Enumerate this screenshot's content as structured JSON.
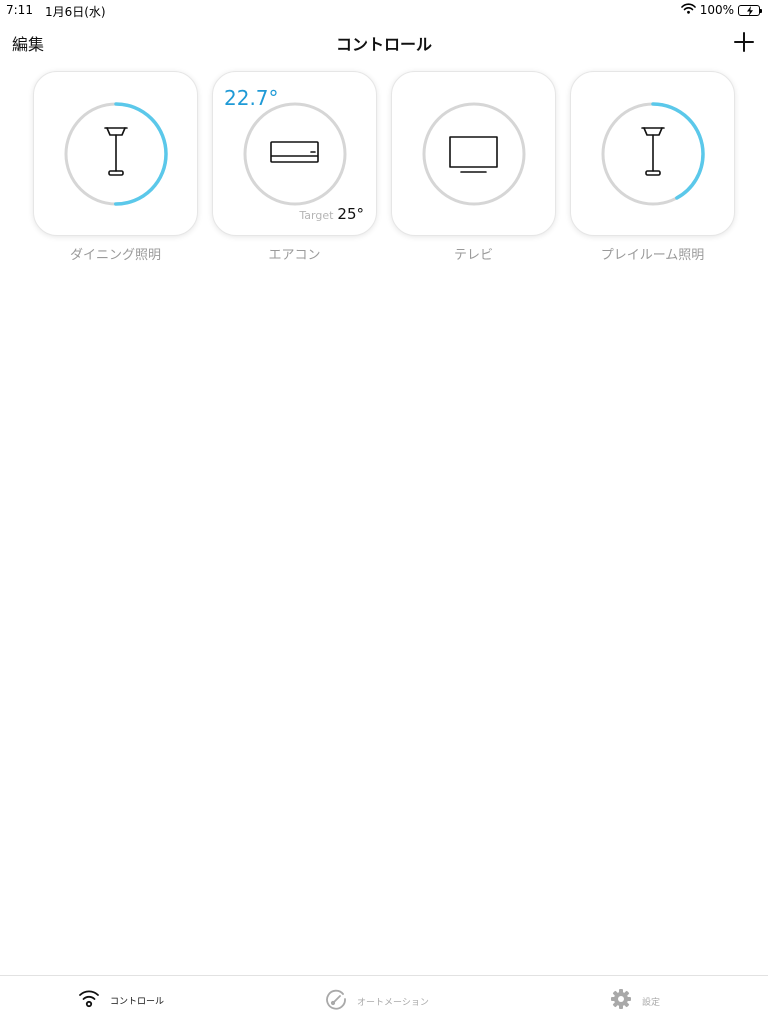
{
  "status_bar": {
    "time": "7:11",
    "date": "1月6日(水)",
    "battery": "100%"
  },
  "nav": {
    "edit_label": "編集",
    "title": "コントロール",
    "add_icon": "plus-icon"
  },
  "accent_color": "#5bc8ea",
  "devices": [
    {
      "label": "ダイニング照明",
      "icon": "floor-lamp-icon",
      "level": 0.5
    },
    {
      "label": "エアコン",
      "icon": "air-conditioner-icon",
      "current_temp": "22.7°",
      "target_label": "Target",
      "target_temp": "25°"
    },
    {
      "label": "テレビ",
      "icon": "tv-icon"
    },
    {
      "label": "プレイルーム照明",
      "icon": "floor-lamp-icon",
      "level": 0.42
    }
  ],
  "tabs": [
    {
      "label": "コントロール",
      "icon": "wifi-icon",
      "active": true
    },
    {
      "label": "オートメーション",
      "icon": "gauge-icon",
      "active": false
    },
    {
      "label": "設定",
      "icon": "gear-icon",
      "active": false
    }
  ]
}
